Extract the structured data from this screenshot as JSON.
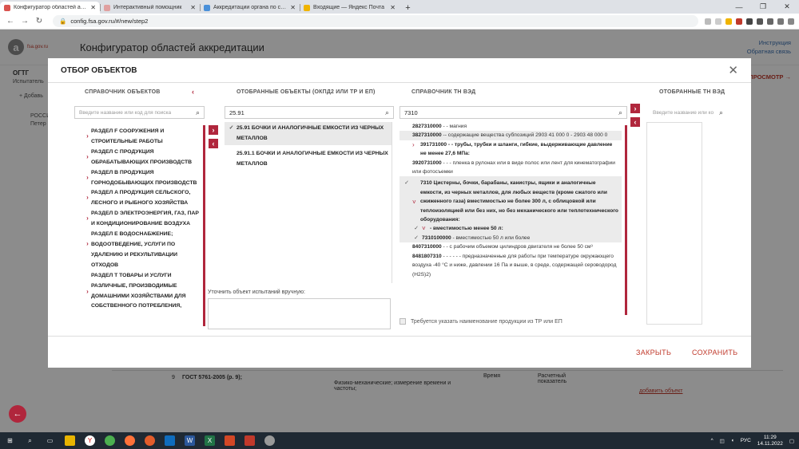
{
  "browser": {
    "tabs": [
      {
        "label": "Конфигуратор областей аккред...",
        "active": true,
        "color": "#d9534f"
      },
      {
        "label": "Интерактивный помощник",
        "active": false,
        "color": "#e0a0a0"
      },
      {
        "label": "Аккредитации органа по серти...",
        "active": false,
        "color": "#4a90d9"
      },
      {
        "label": "Входящие — Яндекс Почта",
        "active": false,
        "color": "#f0b400"
      }
    ],
    "new_tab": "+",
    "url": "config.fsa.gov.ru/#/new/step2"
  },
  "site": {
    "logo_text": "a",
    "logo_sub": "fsa.gov.ru",
    "title": "Конфигуратор областей аккредитации",
    "link_instruction": "Инструкция",
    "link_feedback": "Обратная связь",
    "left_title": "ОГТГ",
    "left_sub": "Испытатель",
    "right_btn": "ПРОСМОТР →"
  },
  "modal": {
    "title": "ОТБОР ОБЪЕКТОВ",
    "col1_head": "СПРАВОЧНИК ОБЪЕКТОВ",
    "col2_head": "ОТОБРАННЫЕ ОБЪЕКТЫ (ОКПД2 ИЛИ ТР И ЕП)",
    "col3_head": "СПРАВОЧНИК ТН ВЭД",
    "col4_head": "ОТОБРАННЫЕ ТН ВЭД",
    "search1_placeholder": "Введите название или код для поиска",
    "search2_value": "25.91",
    "search3_value": "7310",
    "search4_placeholder": "Введите название или ко",
    "catalog": [
      "РАЗДЕЛ F СООРУЖЕНИЯ И СТРОИТЕЛЬНЫЕ РАБОТЫ",
      "РАЗДЕЛ C ПРОДУКЦИЯ ОБРАБАТЫВАЮЩИХ ПРОИЗВОДСТВ",
      "РАЗДЕЛ B ПРОДУКЦИЯ ГОРНОДОБЫВАЮЩИХ ПРОИЗВОДСТВ",
      "РАЗДЕЛ A ПРОДУКЦИЯ СЕЛЬСКОГО, ЛЕСНОГО И РЫБНОГО ХОЗЯЙСТВА",
      "РАЗДЕЛ D ЭЛЕКТРОЭНЕРГИЯ, ГАЗ, ПАР И КОНДИЦИОНИРОВАНИЕ ВОЗДУХА",
      "РАЗДЕЛ E ВОДОСНАБЖЕНИЕ; ВОДООТВЕДЕНИЕ, УСЛУГИ ПО УДАЛЕНИЮ И РЕКУЛЬТИВАЦИИ ОТХОДОВ",
      "РАЗДЕЛ T ТОВАРЫ И УСЛУГИ РАЗЛИЧНЫЕ, ПРОИЗВОДИМЫЕ ДОМАШНИМИ ХОЗЯЙСТВАМИ ДЛЯ СОБСТВЕННОГО ПОТРЕБЛЕНИЯ,"
    ],
    "selected": [
      {
        "text": "25.91 БОЧКИ И АНАЛОГИЧНЫЕ ЕМКОСТИ ИЗ ЧЕРНЫХ МЕТАЛЛОВ",
        "checked": true
      },
      {
        "text": "25.91.1 БОЧКИ И АНАЛОГИЧНЫЕ ЕМКОСТИ ИЗ ЧЕРНЫХ МЕТАЛЛОВ",
        "checked": false
      }
    ],
    "manual_label": "Уточнить объект испытаний вручную:",
    "tnved": [
      {
        "code": "2827310000",
        "text": " - - магния",
        "hl": false,
        "ck": "",
        "bold": false,
        "chev": false
      },
      {
        "code": "3827310000",
        "text": " -- содержащие вещества субпозиций 2903 41 000 0 - 2903 48 000 0",
        "hl": true,
        "ck": "",
        "bold": false,
        "chev": false
      },
      {
        "code": "391731000",
        "text": " - - трубы, трубки и шланги, гибкие, выдерживающие давление не менее 27,6 МПа:",
        "hl": false,
        "ck": "",
        "bold": true,
        "chev": true
      },
      {
        "code": "3920731000",
        "text": " - - - пленка в рулонах или в виде полос или лент для кинематографии или фотосъемки",
        "hl": false,
        "ck": "",
        "bold": false,
        "chev": false
      },
      {
        "code": "7310",
        "text": " Цистерны, бочки, барабаны, канистры, ящики и аналогичные емкости, из черных металлов, для любых веществ (кроме сжатого или сжиженного газа) вместимостью не более 300 л, с облицовкой или теплоизоляцией или без них, но без механического или теплотехнического оборудования:",
        "hl": true,
        "ck": "✓",
        "bold": true,
        "chev": true
      },
      {
        "code": "",
        "text": "- вместимостью менее 50 л:",
        "hl": true,
        "ck": "✓",
        "bold": true,
        "chev": true
      },
      {
        "code": "7310100000",
        "text": " - вместимостью 50 л или более",
        "hl": true,
        "ck": "✓",
        "bold": false,
        "chev": false
      },
      {
        "code": "8407310000",
        "text": " - - с рабочим объемом цилиндров двигателя не более 50 см³",
        "hl": false,
        "ck": "",
        "bold": false,
        "chev": false
      },
      {
        "code": "8481807310",
        "text": " - - - - - - предназначенные для работы при температуре окружающего воздуха -40 °С и ниже, давлении 16 Па и выше, в среде, содержащей сероводород (H2S)2)",
        "hl": false,
        "ck": "",
        "bold": false,
        "chev": false
      }
    ],
    "need_name_label": "Требуется указать наименование продукции из ТР или ЕП",
    "close_btn": "ЗАКРЫТЬ",
    "save_btn": "СОХРАНИТЬ"
  },
  "under": {
    "row_num": "9",
    "row_doc": "ГОСТ 5761-2005 (р. 9);",
    "row_method": "Физико-механические; измерение времени и частоты;",
    "row_time": "Время",
    "row_param": "Расчетный показатель",
    "row_add": "добавить объект",
    "add_btn": "+ Добавь",
    "russia": "РОССИ",
    "peter": "Петер"
  },
  "taskbar": {
    "lang": "РУС",
    "time": "11:29",
    "date": "14.11.2022"
  }
}
